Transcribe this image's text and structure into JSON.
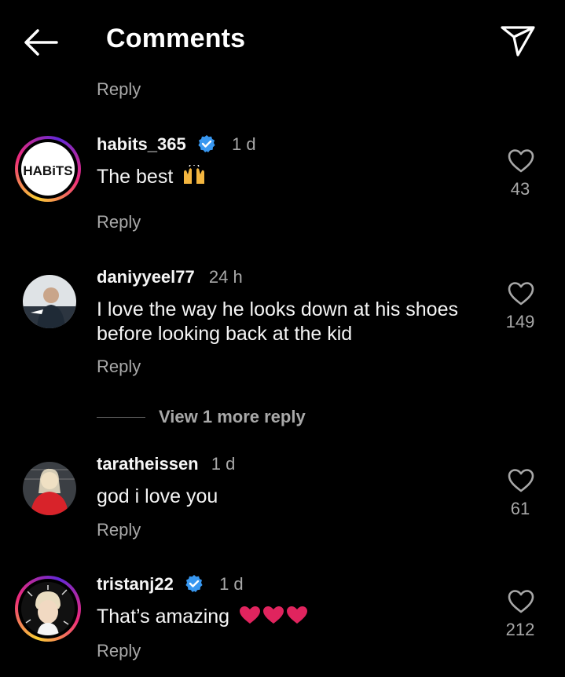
{
  "header": {
    "title": "Comments"
  },
  "top_reply": "Reply",
  "comments": [
    {
      "username": "habits_365",
      "verified": true,
      "time": "1 d",
      "text": "The best",
      "emoji": "raising-hands",
      "likes": "43",
      "reply": "Reply",
      "avatar_logo": "HABiTS"
    },
    {
      "username": "daniyyeel77",
      "verified": false,
      "time": "24 h",
      "text_line1": "I love the way he looks down at his shoes",
      "text_line2": "before looking back at the kid",
      "likes": "149",
      "reply": "Reply"
    },
    {
      "username": "taratheissen",
      "verified": false,
      "time": "1 d",
      "text": "god i love you",
      "likes": "61",
      "reply": "Reply"
    },
    {
      "username": "tristanj22",
      "verified": true,
      "time": "1 d",
      "text": "That’s amazing",
      "emoji": "three-red-hearts",
      "likes": "212",
      "reply": "Reply"
    }
  ],
  "view_more": "View 1 more reply",
  "colors": {
    "background": "#000000",
    "text": "#f5f5f5",
    "muted": "#a8a8a8",
    "verified": "#3897f0",
    "heart_red": "#e0245e"
  }
}
